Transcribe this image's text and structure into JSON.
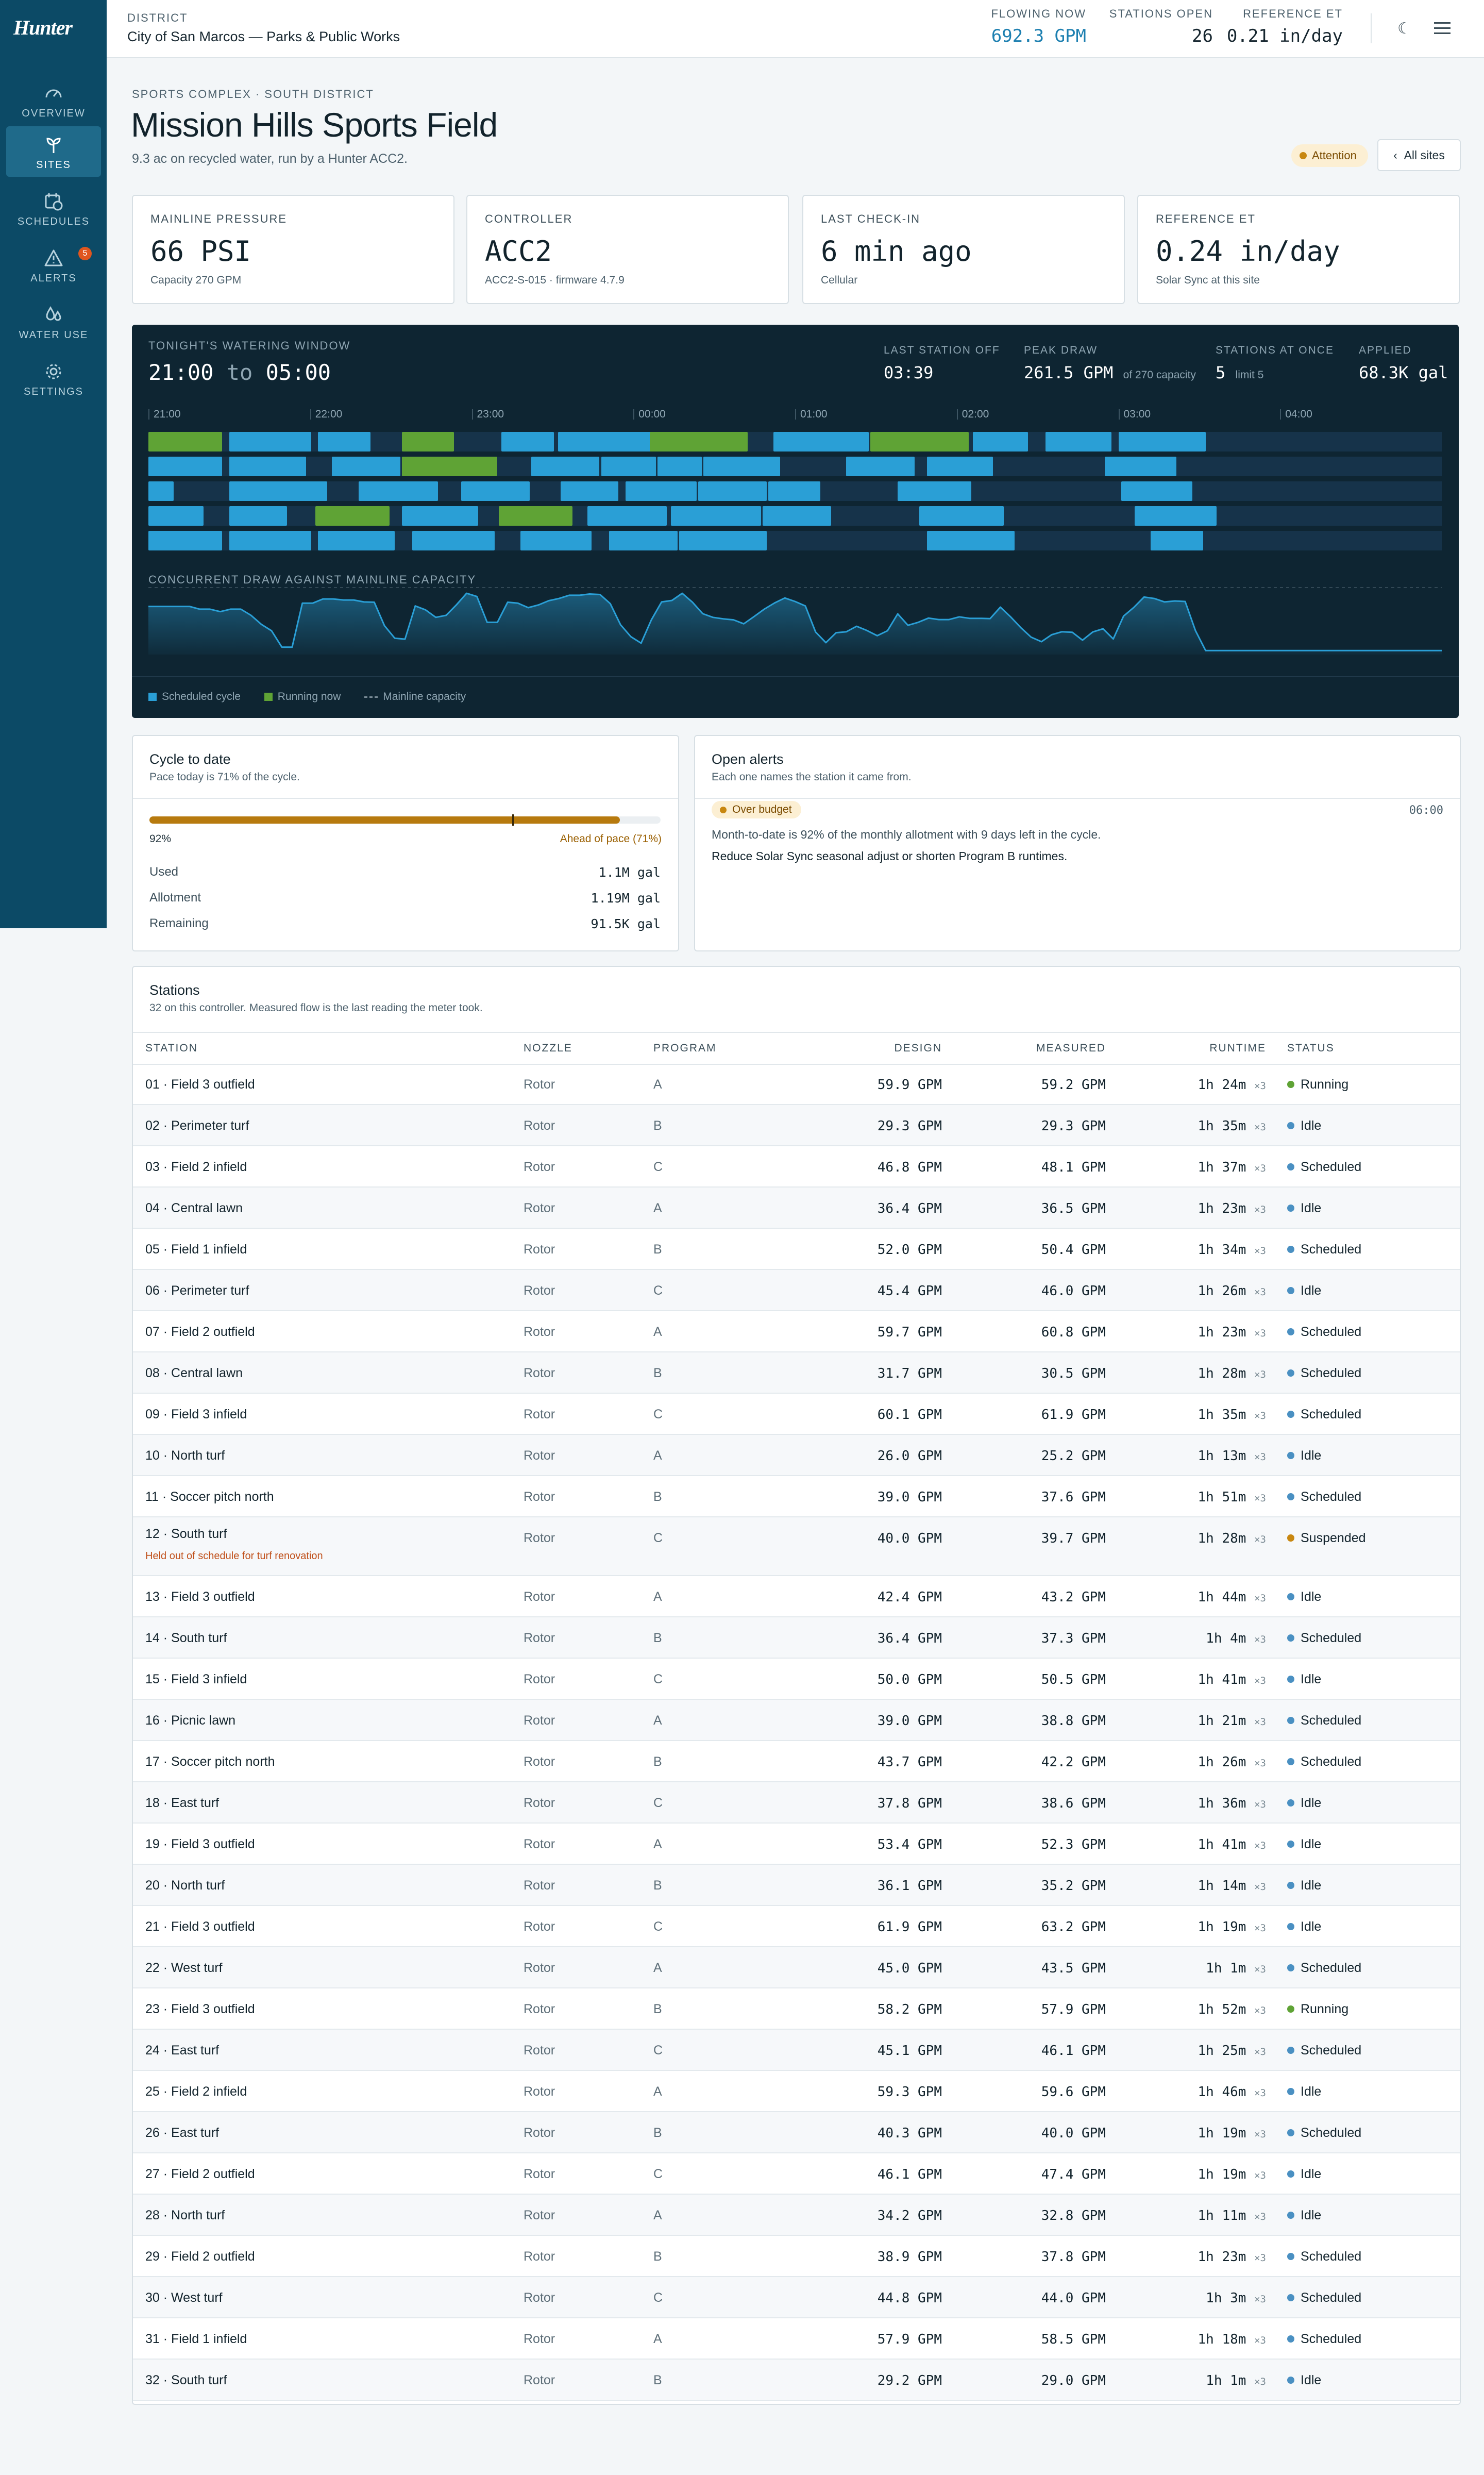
{
  "app": {
    "logo": "Hunter"
  },
  "topbar": {
    "district_label": "DISTRICT",
    "district_value": "City of San Marcos — Parks & Public Works",
    "stats": [
      {
        "label": "FLOWING NOW",
        "value": "692.3 GPM"
      },
      {
        "label": "STATIONS OPEN",
        "value": "26"
      },
      {
        "label": "REFERENCE ET",
        "value": "0.21 in/day"
      }
    ],
    "icons": [
      "moon-icon",
      "menu-icon"
    ]
  },
  "sidebar": {
    "items": [
      {
        "label": "OVERVIEW",
        "icon": "gauge-icon"
      },
      {
        "label": "SITES",
        "icon": "sprout-icon",
        "active": true
      },
      {
        "label": "SCHEDULES",
        "icon": "calendar-clock-icon"
      },
      {
        "label": "ALERTS",
        "icon": "warning-icon",
        "badge": "5"
      },
      {
        "label": "WATER USE",
        "icon": "droplets-icon"
      },
      {
        "label": "SETTINGS",
        "icon": "gear-icon"
      }
    ]
  },
  "header": {
    "breadcrumb": "SPORTS COMPLEX · SOUTH DISTRICT",
    "title": "Mission Hills Sports Field",
    "subtitle": "9.3 ac on recycled water, run by a Hunter ACC2.",
    "status_badge": "Attention",
    "all_sites": "All sites"
  },
  "cards": [
    {
      "label": "MAINLINE PRESSURE",
      "value": "66 PSI",
      "sub": "Capacity 270 GPM"
    },
    {
      "label": "CONTROLLER",
      "value": "ACC2",
      "sub": "ACC2-S-015 · firmware 4.7.9"
    },
    {
      "label": "LAST CHECK-IN",
      "value": "6 min ago",
      "sub": "Cellular"
    },
    {
      "label": "REFERENCE ET",
      "value": "0.24 in/day",
      "sub": "Solar Sync at this site"
    }
  ],
  "window": {
    "label": "TONIGHT'S WATERING WINDOW",
    "start": "21:00",
    "to": "to",
    "end": "05:00",
    "stats": [
      {
        "label": "LAST STATION OFF",
        "value": "03:39",
        "note": ""
      },
      {
        "label": "PEAK DRAW",
        "value": "261.5 GPM",
        "note": "of 270 capacity"
      },
      {
        "label": "STATIONS AT ONCE",
        "value": "5",
        "note": "limit 5"
      },
      {
        "label": "APPLIED",
        "value": "68.3K gal",
        "note": ""
      }
    ],
    "ticks": [
      "21:00",
      "22:00",
      "23:00",
      "00:00",
      "01:00",
      "02:00",
      "03:00",
      "04:00"
    ],
    "lanes": [
      [
        [
          "21:00",
          "21:28",
          "run"
        ],
        [
          "21:30",
          "22:01",
          "s"
        ],
        [
          "22:03",
          "22:23",
          "s"
        ],
        [
          "22:34",
          "22:54",
          "run"
        ],
        [
          "23:11",
          "23:31",
          "s"
        ],
        [
          "23:32",
          "24:08",
          "s"
        ],
        [
          "24:06",
          "24:43",
          "run"
        ],
        [
          "24:52",
          "25:28",
          "s"
        ],
        [
          "25:28",
          "26:05",
          "run"
        ],
        [
          "26:06",
          "26:27",
          "s"
        ],
        [
          "26:33",
          "26:58",
          "s"
        ],
        [
          "27:00",
          "27:33",
          "s"
        ]
      ],
      [
        [
          "21:00",
          "21:28",
          "s"
        ],
        [
          "21:30",
          "21:59",
          "s"
        ],
        [
          "22:08",
          "22:34",
          "s"
        ],
        [
          "22:34",
          "23:10",
          "run"
        ],
        [
          "23:22",
          "23:48",
          "s"
        ],
        [
          "23:48",
          "24:09",
          "s"
        ],
        [
          "24:09",
          "24:26",
          "s"
        ],
        [
          "24:26",
          "24:55",
          "s"
        ],
        [
          "25:19",
          "25:45",
          "s"
        ],
        [
          "25:49",
          "26:14",
          "s"
        ],
        [
          "26:55",
          "27:22",
          "s"
        ]
      ],
      [
        [
          "21:00",
          "21:10",
          "s"
        ],
        [
          "21:30",
          "22:07",
          "s"
        ],
        [
          "22:18",
          "22:48",
          "s"
        ],
        [
          "22:56",
          "23:22",
          "s"
        ],
        [
          "23:33",
          "23:55",
          "s"
        ],
        [
          "23:57",
          "24:24",
          "s"
        ],
        [
          "24:24",
          "24:50",
          "s"
        ],
        [
          "24:50",
          "25:10",
          "s"
        ],
        [
          "25:38",
          "26:06",
          "s"
        ],
        [
          "27:01",
          "27:28",
          "s"
        ]
      ],
      [
        [
          "21:00",
          "21:21",
          "s"
        ],
        [
          "21:30",
          "21:52",
          "s"
        ],
        [
          "22:02",
          "22:30",
          "run"
        ],
        [
          "22:34",
          "23:03",
          "s"
        ],
        [
          "23:10",
          "23:38",
          "run"
        ],
        [
          "23:43",
          "24:13",
          "s"
        ],
        [
          "24:14",
          "24:48",
          "s"
        ],
        [
          "24:48",
          "25:14",
          "s"
        ],
        [
          "25:46",
          "26:18",
          "s"
        ],
        [
          "27:06",
          "27:37",
          "s"
        ]
      ],
      [
        [
          "21:00",
          "21:28",
          "s"
        ],
        [
          "21:30",
          "22:01",
          "s"
        ],
        [
          "22:03",
          "22:32",
          "s"
        ],
        [
          "22:38",
          "23:09",
          "s"
        ],
        [
          "23:18",
          "23:45",
          "s"
        ],
        [
          "23:51",
          "24:17",
          "s"
        ],
        [
          "24:17",
          "24:50",
          "s"
        ],
        [
          "25:49",
          "26:22",
          "s"
        ],
        [
          "27:12",
          "27:32",
          "s"
        ]
      ]
    ],
    "draw_label": "CONCURRENT DRAW AGAINST MAINLINE CAPACITY",
    "legend": [
      "Scheduled cycle",
      "Running now",
      "Mainline capacity"
    ],
    "colors": {
      "scheduled": "#2a9fd6",
      "running": "#5fa335",
      "capacity": "#7a8c97"
    }
  },
  "chart_data": {
    "type": "area",
    "title": "CONCURRENT DRAW AGAINST MAINLINE CAPACITY",
    "xlabel": "",
    "ylabel": "",
    "ylim": [
      0,
      270
    ],
    "capacity": 270,
    "peak": 261.5,
    "x_range": [
      "21:00",
      "05:00"
    ],
    "values": [
      194,
      194,
      194,
      194,
      194,
      183,
      183,
      173,
      183,
      183,
      158,
      122,
      96,
      30,
      30,
      207,
      207,
      224,
      224,
      220,
      220,
      212,
      211,
      116,
      66,
      62,
      196,
      180,
      150,
      158,
      200,
      247,
      234,
      130,
      130,
      211,
      207,
      189,
      200,
      217,
      226,
      239,
      239,
      244,
      242,
      205,
      120,
      72,
      46,
      140,
      212,
      218,
      247,
      211,
      165,
      150,
      144,
      140,
      124,
      153,
      183,
      208,
      228,
      214,
      196,
      91,
      48,
      88,
      92,
      114,
      97,
      76,
      96,
      164,
      118,
      130,
      147,
      141,
      141,
      152,
      146,
      146,
      145,
      191,
      152,
      108,
      70,
      52,
      80,
      92,
      90,
      58,
      91,
      104,
      63,
      155,
      190,
      232,
      226,
      212,
      216,
      214,
      97,
      16,
      16,
      16,
      16,
      16,
      16,
      16,
      16,
      16,
      16,
      16,
      16,
      16,
      16,
      16,
      16,
      16,
      16,
      16,
      16,
      16,
      16,
      16,
      16
    ]
  },
  "cycle": {
    "title": "Cycle to date",
    "subtitle": "Pace today is 71% of the cycle.",
    "used_fraction": 0.92,
    "pace_fraction": 0.71,
    "pct_label": "92%",
    "ahead_label": "Ahead of pace (71%)",
    "rows": [
      {
        "k": "Used",
        "v": "1.1M gal"
      },
      {
        "k": "Allotment",
        "v": "1.19M gal"
      },
      {
        "k": "Remaining",
        "v": "91.5K gal"
      }
    ]
  },
  "alerts": {
    "title": "Open alerts",
    "subtitle": "Each one names the station it came from.",
    "badge": "Over budget",
    "time": "06:00",
    "message": "Month-to-date is 92% of the monthly allotment with 9 days left in the cycle.",
    "action": "Reduce Solar Sync seasonal adjust or shorten Program B runtimes."
  },
  "stations": {
    "title": "Stations",
    "subtitle": "32 on this controller. Measured flow is the last reading the meter took.",
    "columns": [
      "STATION",
      "NOZZLE",
      "PROGRAM",
      "DESIGN",
      "MEASURED",
      "RUNTIME",
      "STATUS"
    ],
    "status_colors": {
      "Running": "#5fa335",
      "Idle": "#4a90c2",
      "Scheduled": "#4a90c2",
      "Suspended": "#c88710"
    },
    "rows": [
      {
        "station": "01 · Field 3 outfield",
        "nozzle": "Rotor",
        "program": "A",
        "design": "59.9 GPM",
        "measured": "59.2 GPM",
        "runtime": "1h 24m",
        "mult": "×3",
        "status": "Running",
        "note": ""
      },
      {
        "station": "02 · Perimeter turf",
        "nozzle": "Rotor",
        "program": "B",
        "design": "29.3 GPM",
        "measured": "29.3 GPM",
        "runtime": "1h 35m",
        "mult": "×3",
        "status": "Idle",
        "note": ""
      },
      {
        "station": "03 · Field 2 infield",
        "nozzle": "Rotor",
        "program": "C",
        "design": "46.8 GPM",
        "measured": "48.1 GPM",
        "runtime": "1h 37m",
        "mult": "×3",
        "status": "Scheduled",
        "note": ""
      },
      {
        "station": "04 · Central lawn",
        "nozzle": "Rotor",
        "program": "A",
        "design": "36.4 GPM",
        "measured": "36.5 GPM",
        "runtime": "1h 23m",
        "mult": "×3",
        "status": "Idle",
        "note": ""
      },
      {
        "station": "05 · Field 1 infield",
        "nozzle": "Rotor",
        "program": "B",
        "design": "52.0 GPM",
        "measured": "50.4 GPM",
        "runtime": "1h 34m",
        "mult": "×3",
        "status": "Scheduled",
        "note": ""
      },
      {
        "station": "06 · Perimeter turf",
        "nozzle": "Rotor",
        "program": "C",
        "design": "45.4 GPM",
        "measured": "46.0 GPM",
        "runtime": "1h 26m",
        "mult": "×3",
        "status": "Idle",
        "note": ""
      },
      {
        "station": "07 · Field 2 outfield",
        "nozzle": "Rotor",
        "program": "A",
        "design": "59.7 GPM",
        "measured": "60.8 GPM",
        "runtime": "1h 23m",
        "mult": "×3",
        "status": "Scheduled",
        "note": ""
      },
      {
        "station": "08 · Central lawn",
        "nozzle": "Rotor",
        "program": "B",
        "design": "31.7 GPM",
        "measured": "30.5 GPM",
        "runtime": "1h 28m",
        "mult": "×3",
        "status": "Scheduled",
        "note": ""
      },
      {
        "station": "09 · Field 3 infield",
        "nozzle": "Rotor",
        "program": "C",
        "design": "60.1 GPM",
        "measured": "61.9 GPM",
        "runtime": "1h 35m",
        "mult": "×3",
        "status": "Scheduled",
        "note": ""
      },
      {
        "station": "10 · North turf",
        "nozzle": "Rotor",
        "program": "A",
        "design": "26.0 GPM",
        "measured": "25.2 GPM",
        "runtime": "1h 13m",
        "mult": "×3",
        "status": "Idle",
        "note": ""
      },
      {
        "station": "11 · Soccer pitch north",
        "nozzle": "Rotor",
        "program": "B",
        "design": "39.0 GPM",
        "measured": "37.6 GPM",
        "runtime": "1h 51m",
        "mult": "×3",
        "status": "Scheduled",
        "note": ""
      },
      {
        "station": "12 · South turf",
        "nozzle": "Rotor",
        "program": "C",
        "design": "40.0 GPM",
        "measured": "39.7 GPM",
        "runtime": "1h 28m",
        "mult": "×3",
        "status": "Suspended",
        "note": "Held out of schedule for turf renovation"
      },
      {
        "station": "13 · Field 3 outfield",
        "nozzle": "Rotor",
        "program": "A",
        "design": "42.4 GPM",
        "measured": "43.2 GPM",
        "runtime": "1h 44m",
        "mult": "×3",
        "status": "Idle",
        "note": ""
      },
      {
        "station": "14 · South turf",
        "nozzle": "Rotor",
        "program": "B",
        "design": "36.4 GPM",
        "measured": "37.3 GPM",
        "runtime": "1h 4m",
        "mult": "×3",
        "status": "Scheduled",
        "note": ""
      },
      {
        "station": "15 · Field 3 infield",
        "nozzle": "Rotor",
        "program": "C",
        "design": "50.0 GPM",
        "measured": "50.5 GPM",
        "runtime": "1h 41m",
        "mult": "×3",
        "status": "Idle",
        "note": ""
      },
      {
        "station": "16 · Picnic lawn",
        "nozzle": "Rotor",
        "program": "A",
        "design": "39.0 GPM",
        "measured": "38.8 GPM",
        "runtime": "1h 21m",
        "mult": "×3",
        "status": "Scheduled",
        "note": ""
      },
      {
        "station": "17 · Soccer pitch north",
        "nozzle": "Rotor",
        "program": "B",
        "design": "43.7 GPM",
        "measured": "42.2 GPM",
        "runtime": "1h 26m",
        "mult": "×3",
        "status": "Scheduled",
        "note": ""
      },
      {
        "station": "18 · East turf",
        "nozzle": "Rotor",
        "program": "C",
        "design": "37.8 GPM",
        "measured": "38.6 GPM",
        "runtime": "1h 36m",
        "mult": "×3",
        "status": "Idle",
        "note": ""
      },
      {
        "station": "19 · Field 3 outfield",
        "nozzle": "Rotor",
        "program": "A",
        "design": "53.4 GPM",
        "measured": "52.3 GPM",
        "runtime": "1h 41m",
        "mult": "×3",
        "status": "Idle",
        "note": ""
      },
      {
        "station": "20 · North turf",
        "nozzle": "Rotor",
        "program": "B",
        "design": "36.1 GPM",
        "measured": "35.2 GPM",
        "runtime": "1h 14m",
        "mult": "×3",
        "status": "Idle",
        "note": ""
      },
      {
        "station": "21 · Field 3 outfield",
        "nozzle": "Rotor",
        "program": "C",
        "design": "61.9 GPM",
        "measured": "63.2 GPM",
        "runtime": "1h 19m",
        "mult": "×3",
        "status": "Idle",
        "note": ""
      },
      {
        "station": "22 · West turf",
        "nozzle": "Rotor",
        "program": "A",
        "design": "45.0 GPM",
        "measured": "43.5 GPM",
        "runtime": "1h 1m",
        "mult": "×3",
        "status": "Scheduled",
        "note": ""
      },
      {
        "station": "23 · Field 3 outfield",
        "nozzle": "Rotor",
        "program": "B",
        "design": "58.2 GPM",
        "measured": "57.9 GPM",
        "runtime": "1h 52m",
        "mult": "×3",
        "status": "Running",
        "note": ""
      },
      {
        "station": "24 · East turf",
        "nozzle": "Rotor",
        "program": "C",
        "design": "45.1 GPM",
        "measured": "46.1 GPM",
        "runtime": "1h 25m",
        "mult": "×3",
        "status": "Scheduled",
        "note": ""
      },
      {
        "station": "25 · Field 2 infield",
        "nozzle": "Rotor",
        "program": "A",
        "design": "59.3 GPM",
        "measured": "59.6 GPM",
        "runtime": "1h 46m",
        "mult": "×3",
        "status": "Idle",
        "note": ""
      },
      {
        "station": "26 · East turf",
        "nozzle": "Rotor",
        "program": "B",
        "design": "40.3 GPM",
        "measured": "40.0 GPM",
        "runtime": "1h 19m",
        "mult": "×3",
        "status": "Scheduled",
        "note": ""
      },
      {
        "station": "27 · Field 2 outfield",
        "nozzle": "Rotor",
        "program": "C",
        "design": "46.1 GPM",
        "measured": "47.4 GPM",
        "runtime": "1h 19m",
        "mult": "×3",
        "status": "Idle",
        "note": ""
      },
      {
        "station": "28 · North turf",
        "nozzle": "Rotor",
        "program": "A",
        "design": "34.2 GPM",
        "measured": "32.8 GPM",
        "runtime": "1h 11m",
        "mult": "×3",
        "status": "Idle",
        "note": ""
      },
      {
        "station": "29 · Field 2 outfield",
        "nozzle": "Rotor",
        "program": "B",
        "design": "38.9 GPM",
        "measured": "37.8 GPM",
        "runtime": "1h 23m",
        "mult": "×3",
        "status": "Scheduled",
        "note": ""
      },
      {
        "station": "30 · West turf",
        "nozzle": "Rotor",
        "program": "C",
        "design": "44.8 GPM",
        "measured": "44.0 GPM",
        "runtime": "1h 3m",
        "mult": "×3",
        "status": "Scheduled",
        "note": ""
      },
      {
        "station": "31 · Field 1 infield",
        "nozzle": "Rotor",
        "program": "A",
        "design": "57.9 GPM",
        "measured": "58.5 GPM",
        "runtime": "1h 18m",
        "mult": "×3",
        "status": "Scheduled",
        "note": ""
      },
      {
        "station": "32 · South turf",
        "nozzle": "Rotor",
        "program": "B",
        "design": "29.2 GPM",
        "measured": "29.0 GPM",
        "runtime": "1h 1m",
        "mult": "×3",
        "status": "Idle",
        "note": ""
      }
    ]
  }
}
